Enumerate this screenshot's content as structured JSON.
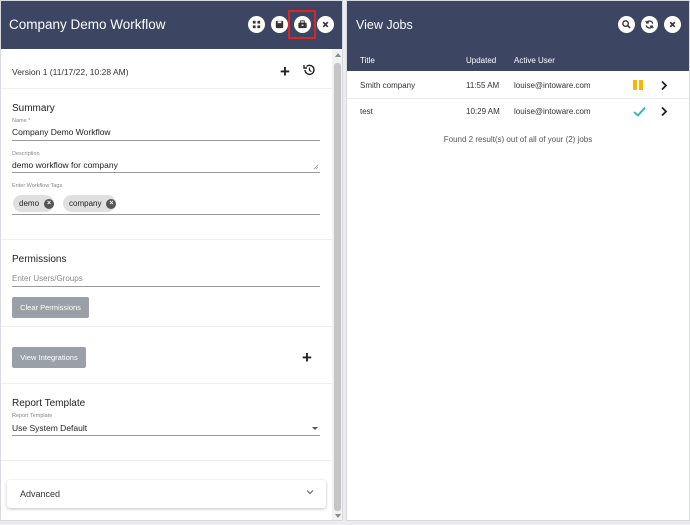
{
  "left_panel": {
    "title": "Company Demo Workflow",
    "header_icons": [
      "grid-icon",
      "save-icon",
      "toolbox-icon",
      "close-icon"
    ],
    "version": "Version 1 (11/17/22, 10:28 AM)",
    "summary": {
      "heading": "Summary",
      "name_label": "Name *",
      "name_value": "Company Demo Workflow",
      "description_label": "Description",
      "description_value": "demo workflow for company",
      "tags_label": "Enter Workflow Tags",
      "tags": [
        "demo",
        "company"
      ]
    },
    "permissions": {
      "heading": "Permissions",
      "placeholder": "Enter Users/Groups",
      "clear_button": "Clear Permissions"
    },
    "integrations": {
      "button": "View Integrations"
    },
    "report_template": {
      "heading": "Report Template",
      "label": "Report Template",
      "value": "Use System Default"
    },
    "advanced": {
      "label": "Advanced"
    }
  },
  "right_panel": {
    "title": "View Jobs",
    "header_icons": [
      "search-icon",
      "refresh-icon",
      "close-icon"
    ],
    "columns": [
      "Title",
      "Updated",
      "Active User"
    ],
    "rows": [
      {
        "title": "Smith company",
        "updated": "11:55 AM",
        "user": "louise@intoware.com",
        "status": "paused"
      },
      {
        "title": "test",
        "updated": "10:29 AM",
        "user": "louise@intoware.com",
        "status": "complete"
      }
    ],
    "footer": "Found 2 result(s) out of all of your (2) jobs"
  },
  "colors": {
    "header_bg": "#3c4562",
    "accent_pause": "#f5b800",
    "accent_check": "#2bb7a5",
    "highlight_box": "#d9232d",
    "button_grey": "#9aa0a8"
  }
}
